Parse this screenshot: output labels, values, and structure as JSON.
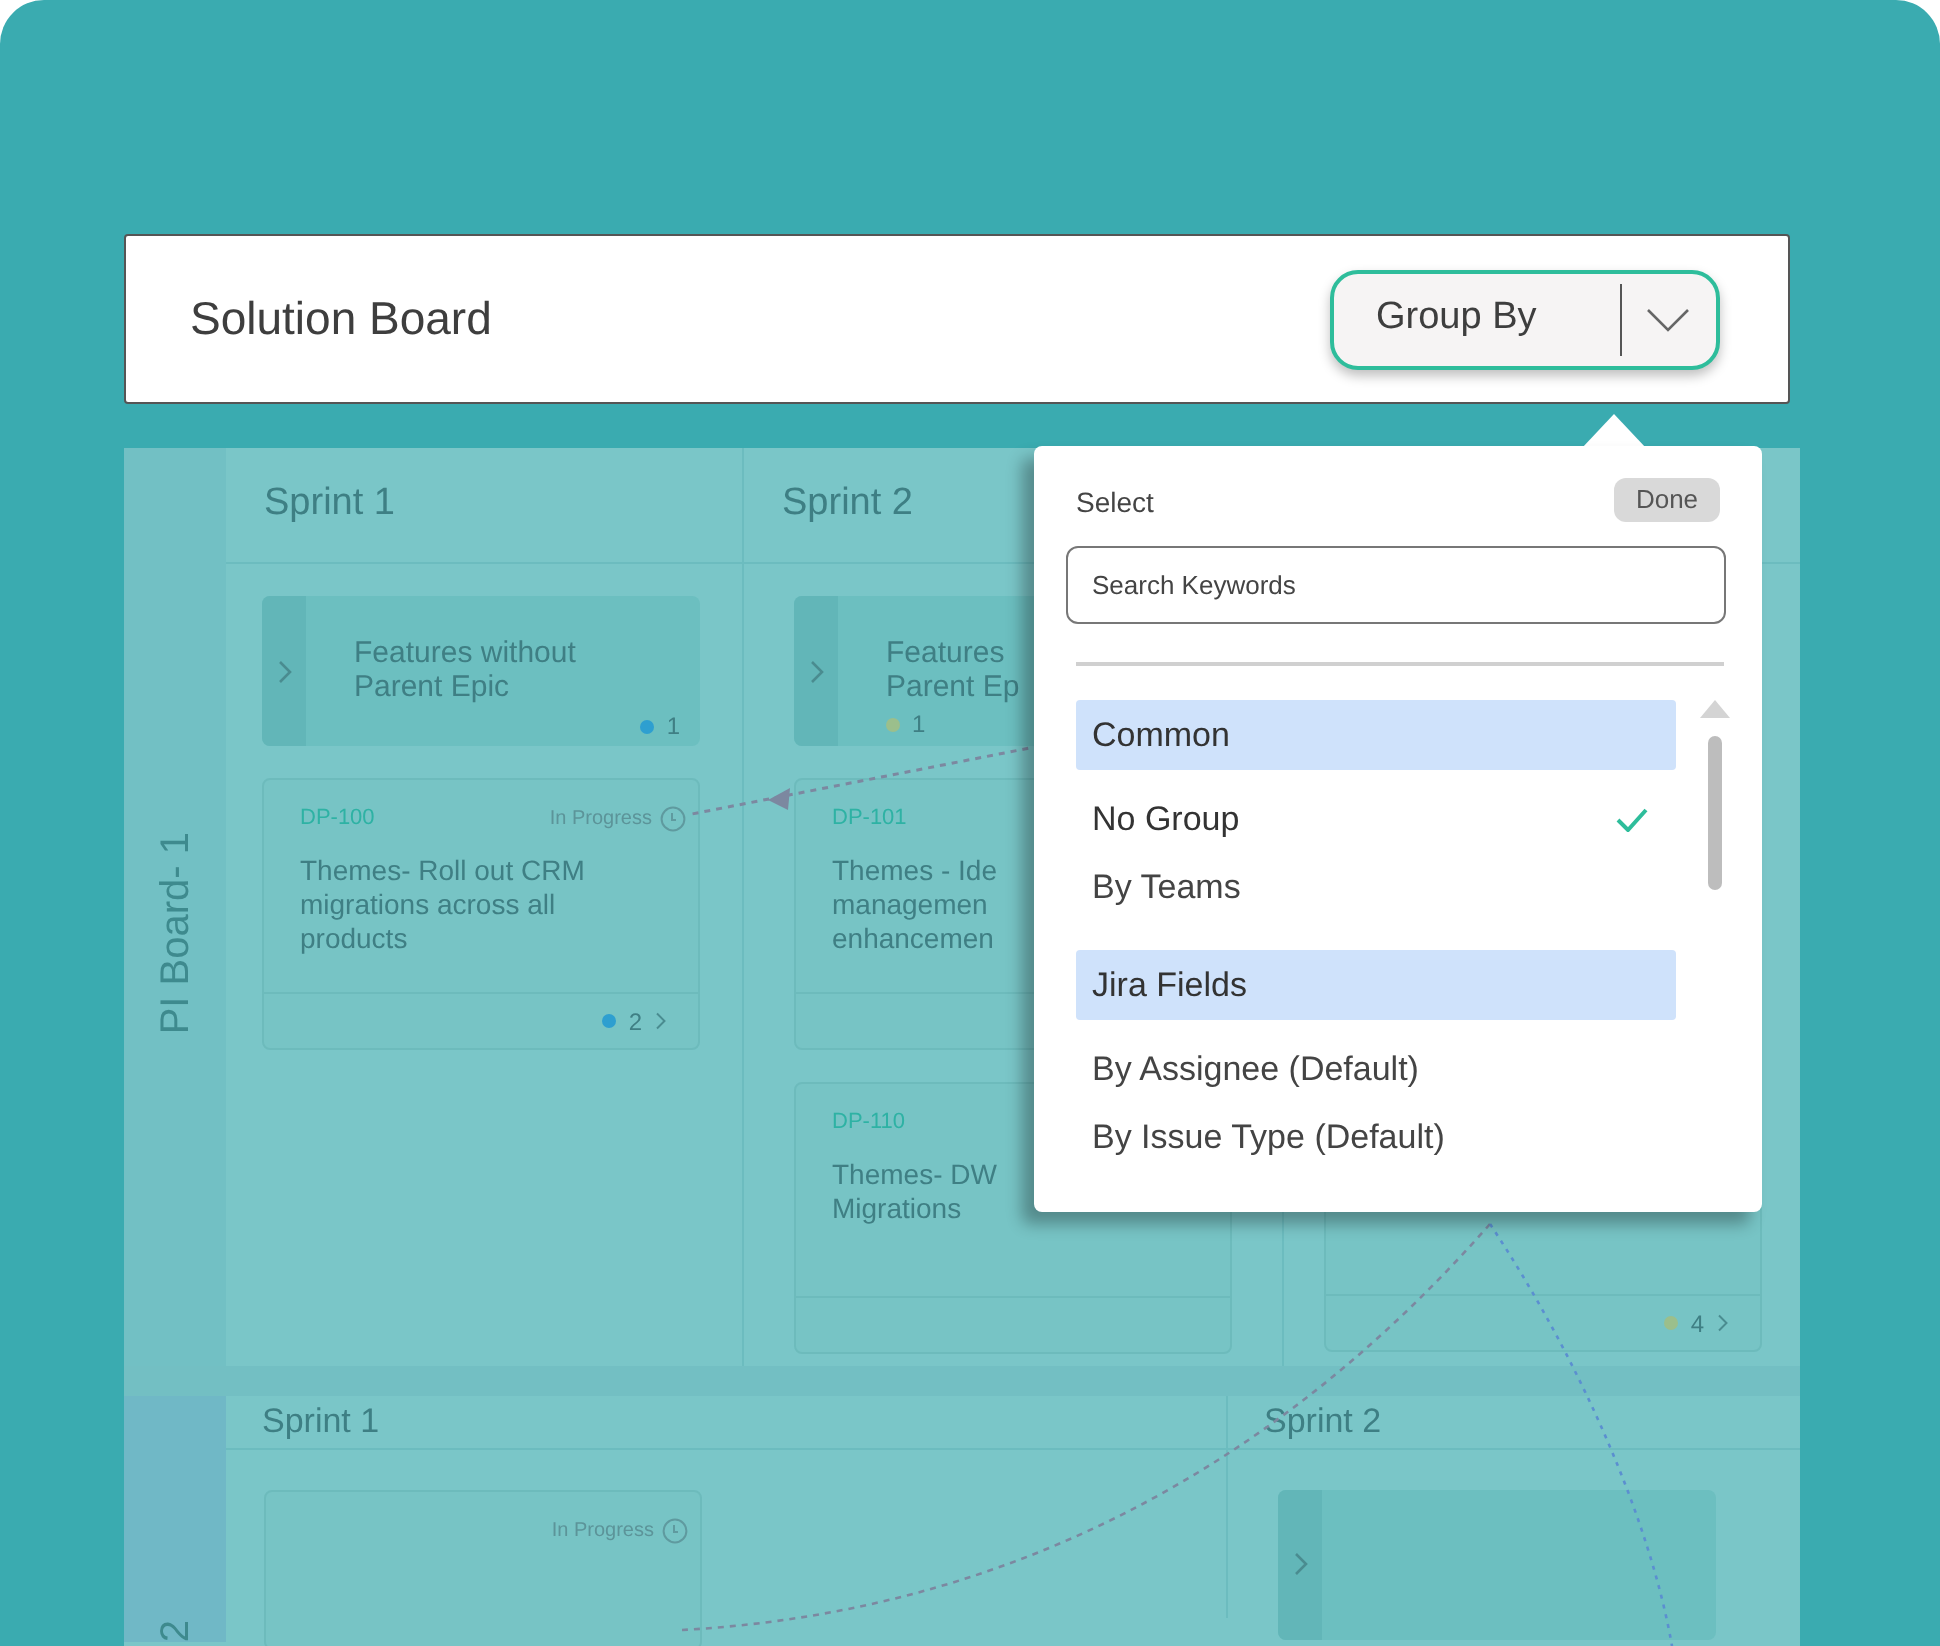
{
  "header": {
    "title": "Solution Board",
    "group_by": {
      "label": "Group By"
    }
  },
  "board": {
    "rows": [
      {
        "label": "PI Board- 1",
        "columns": [
          {
            "title": "Sprint 1",
            "cards": [
              {
                "kind": "epic",
                "lines": [
                  "Features without",
                  "Parent Epic"
                ],
                "count": "1",
                "color": "#2e9fd0"
              },
              {
                "kind": "issue",
                "key": "DP-100",
                "status": "In Progress",
                "lines": [
                  "Themes- Roll out CRM",
                  "migrations across all",
                  "products"
                ],
                "count": "2",
                "color": "#2e9fd0"
              }
            ]
          },
          {
            "title": "Sprint 2",
            "cards": [
              {
                "kind": "epic",
                "lines": [
                  "Features",
                  "Parent Ep"
                ],
                "count": "1",
                "color": "#9bbf8c"
              },
              {
                "kind": "issue",
                "key": "DP-101",
                "lines": [
                  "Themes - Ide",
                  "managemen",
                  "enhancemen"
                ]
              },
              {
                "kind": "issue",
                "key": "DP-110",
                "lines": [
                  "Themes- DW",
                  "Migrations"
                ]
              }
            ]
          },
          {
            "cards": [
              {
                "kind": "issue",
                "count": "4",
                "color": "#9bbf8c"
              }
            ]
          }
        ]
      },
      {
        "label": "2",
        "columns": [
          {
            "title": "Sprint 1",
            "cards": [
              {
                "kind": "issue",
                "status": "In Progress"
              }
            ]
          },
          {
            "title": "Sprint 2",
            "cards": [
              {
                "kind": "epic"
              }
            ]
          }
        ]
      }
    ]
  },
  "group_by_menu": {
    "label": "Select",
    "done": "Done",
    "search": {
      "placeholder": "Search Keywords"
    },
    "groups": [
      {
        "title": "Common",
        "options": [
          {
            "label": "No Group",
            "selected": true
          },
          {
            "label": "By Teams",
            "selected": false
          }
        ]
      },
      {
        "title": "Jira Fields",
        "options": [
          {
            "label": "By Assignee (Default)",
            "selected": false
          },
          {
            "label": "By Issue Type (Default)",
            "selected": false
          }
        ]
      }
    ]
  }
}
